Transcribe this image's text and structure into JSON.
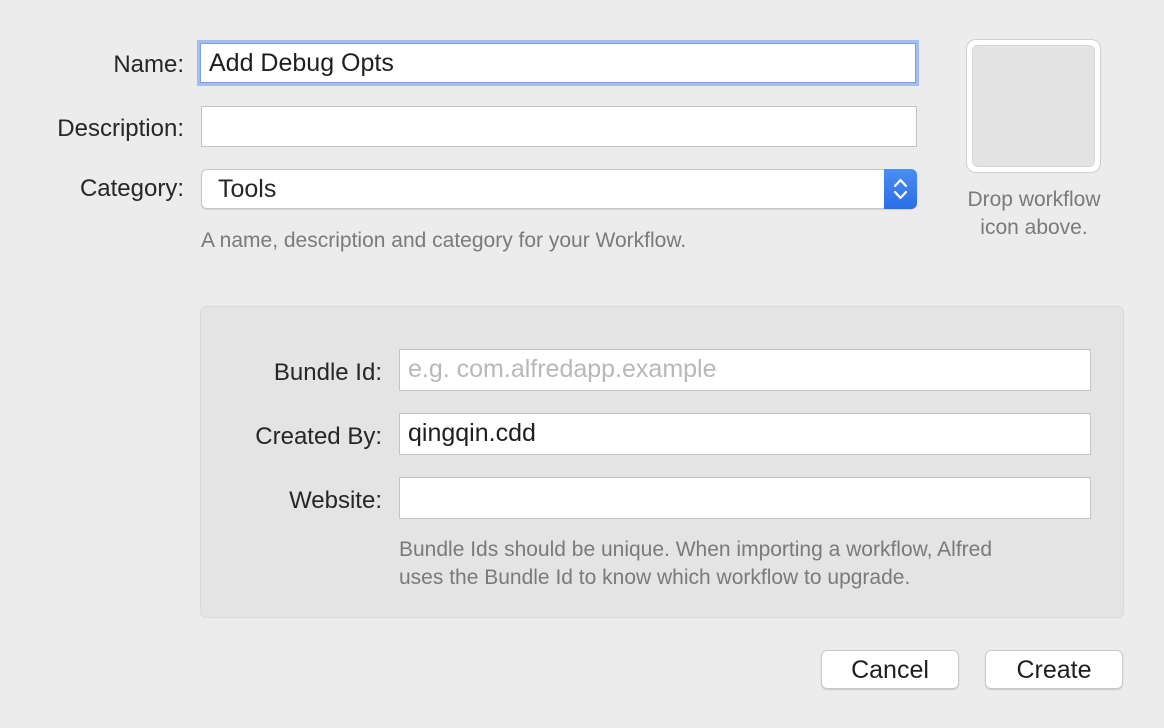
{
  "form": {
    "name_label": "Name:",
    "name_value": "Add Debug Opts",
    "description_label": "Description:",
    "description_value": "",
    "category_label": "Category:",
    "category_value": "Tools",
    "hint": "A name, description and category for your Workflow."
  },
  "icon_well": {
    "caption_line1": "Drop workflow",
    "caption_line2": "icon above."
  },
  "bundle": {
    "bundle_id_label": "Bundle Id:",
    "bundle_id_placeholder": "e.g. com.alfredapp.example",
    "bundle_id_value": "",
    "created_by_label": "Created By:",
    "created_by_value": "qingqin.cdd",
    "website_label": "Website:",
    "website_value": "",
    "hint_line1": "Bundle Ids should be unique. When importing a workflow, Alfred",
    "hint_line2": "uses the Bundle Id to know which workflow to upgrade."
  },
  "buttons": {
    "cancel": "Cancel",
    "create": "Create"
  },
  "colors": {
    "focus_ring": "#a3bdf0",
    "accent": "#2a6ee6",
    "background": "#ececec"
  },
  "icons": {
    "select_stepper": "chevron-up-down-icon"
  }
}
